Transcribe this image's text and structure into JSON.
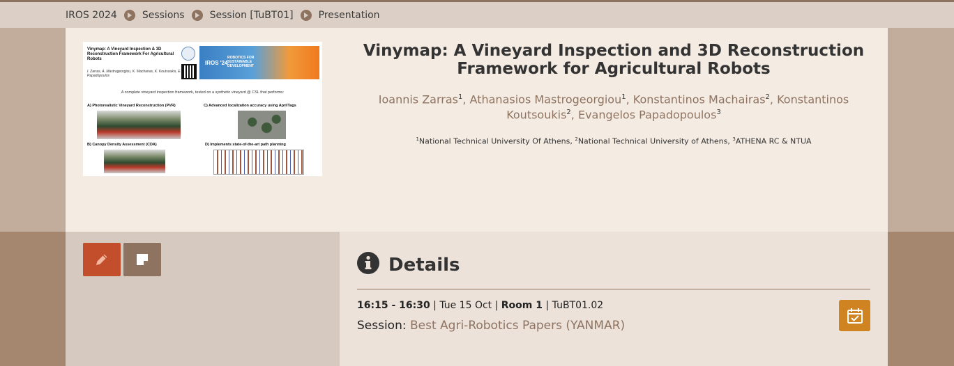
{
  "breadcrumb": {
    "items": [
      "IROS 2024",
      "Sessions",
      "Session [TuBT01]",
      "Presentation"
    ]
  },
  "poster": {
    "title": "Vinymap: A Vineyard Inspection & 3D Reconstruction Framework For Agricultural Robots",
    "authors": "I. Zarras, A. Mastrogeorgiou, K. Machairas, K. Koutsoukis, E. Papadopoulos",
    "banner_text": "ROBOTICS FOR SUSTAINABLE DEVELOPMENT",
    "banner_iros": "IROS '24",
    "subtitle": "A complete vineyard inspection framework, tested on a synthetic vineyard @ CSL that performs:",
    "section_a": "A) Photorealistic Vineyard Reconstruction (PVR)",
    "section_b": "B) Canopy Density Assessment (CDA)",
    "section_c": "C) Advanced localization accuracy using AprilTags",
    "section_d": "D) Implements state-of-the-art path planning"
  },
  "paper": {
    "title": "Vinymap: A Vineyard Inspection and 3D Reconstruction Framework for Agricultural Robots",
    "authors": [
      {
        "name": "Ioannis Zarras",
        "aff": "1"
      },
      {
        "name": "Athanasios Mastrogeorgiou",
        "aff": "1"
      },
      {
        "name": "Konstantinos Machairas",
        "aff": "2"
      },
      {
        "name": "Konstantinos Koutsoukis",
        "aff": "2"
      },
      {
        "name": "Evangelos Papadopoulos",
        "aff": "3"
      }
    ],
    "affiliations": [
      {
        "num": "1",
        "name": "National Technical University Of Athens"
      },
      {
        "num": "2",
        "name": "National Technical University of Athens"
      },
      {
        "num": "3",
        "name": "ATHENA RC & NTUA"
      }
    ]
  },
  "actions": {
    "edit_icon": "pencil-icon",
    "note_icon": "note-icon"
  },
  "details": {
    "heading": "Details",
    "time": "16:15 - 16:30",
    "sep": " | ",
    "date": "Tue 15 Oct",
    "room": "Room 1",
    "code": "TuBT01.02",
    "session_label": "Session:",
    "session_name": "Best Agri-Robotics Papers (YANMAR)",
    "calendar_icon": "calendar-check-icon"
  },
  "colors": {
    "accent_brown": "#8e7361",
    "edit_red": "#c24e2c",
    "calendar_orange": "#cf8421",
    "card_bg": "#f4ebe2"
  }
}
